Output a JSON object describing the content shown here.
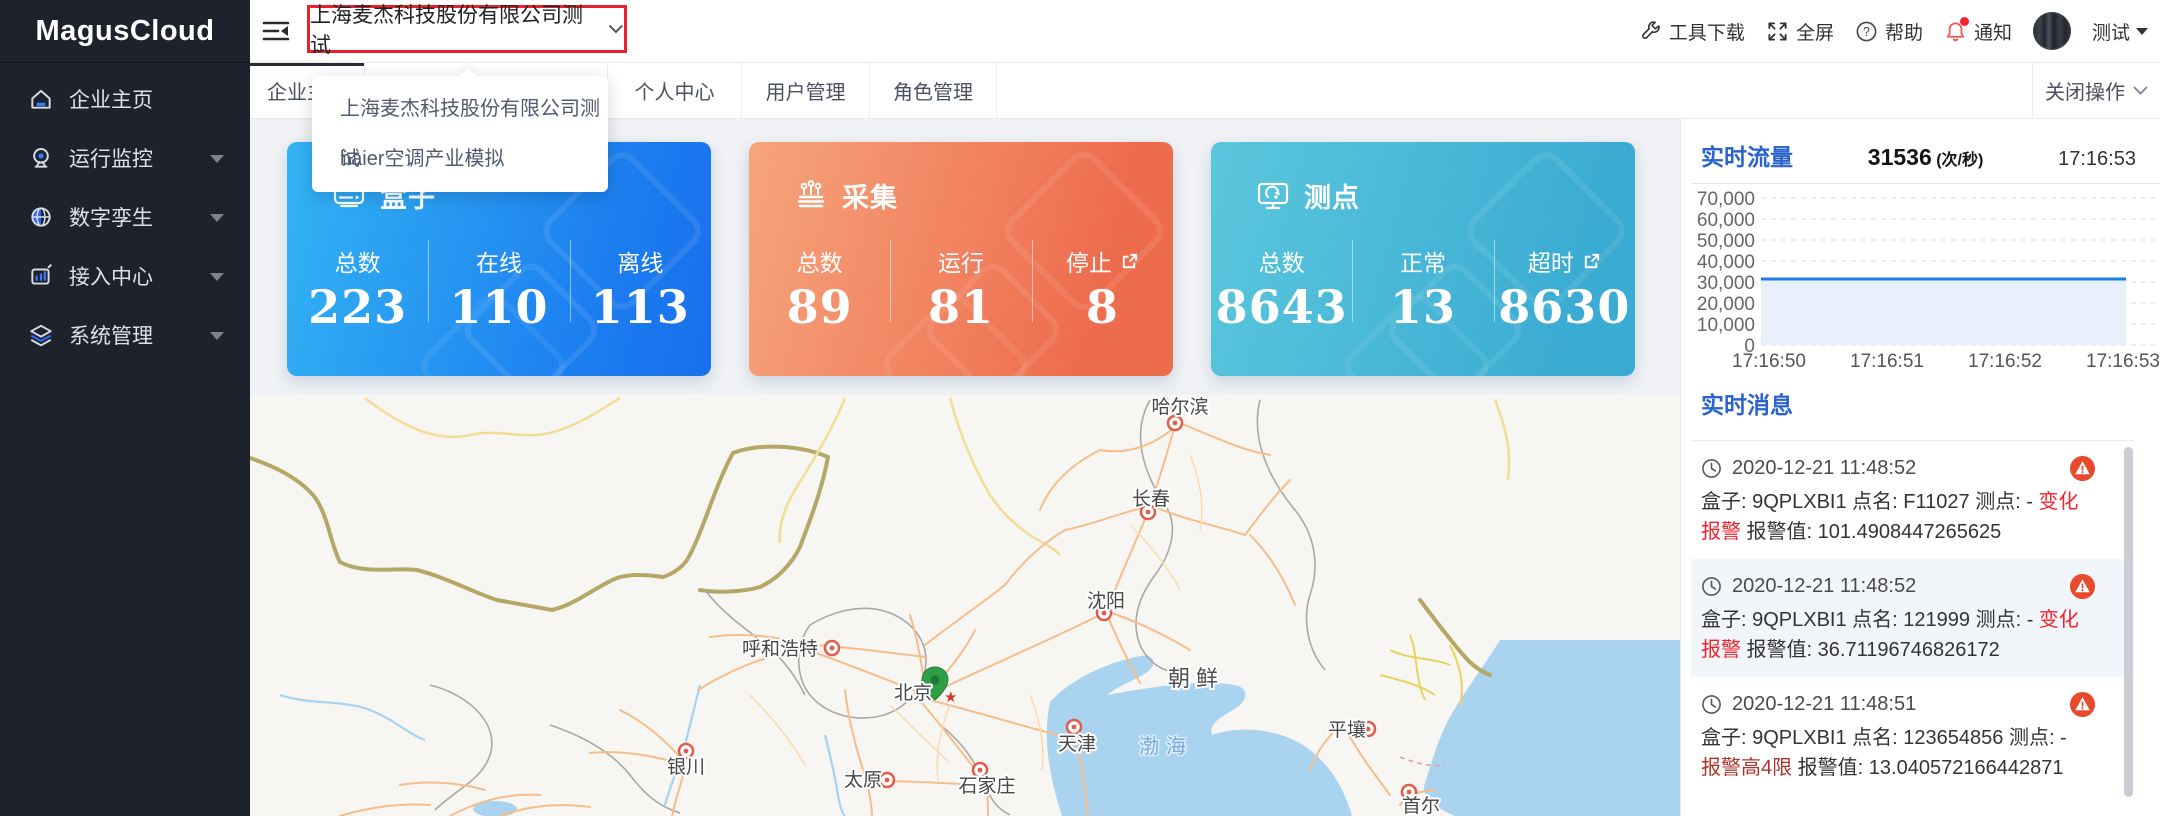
{
  "app": {
    "title": "MagusCloud"
  },
  "sidebar": {
    "items": [
      {
        "label": "企业主页",
        "icon": "home-icon",
        "expandable": false
      },
      {
        "label": "运行监控",
        "icon": "monitor-icon",
        "expandable": true
      },
      {
        "label": "数字孪生",
        "icon": "globe-icon",
        "expandable": true
      },
      {
        "label": "接入中心",
        "icon": "access-icon",
        "expandable": true
      },
      {
        "label": "系统管理",
        "icon": "layers-icon",
        "expandable": true
      }
    ]
  },
  "header": {
    "org_selector": {
      "value": "上海麦杰科技股份有限公司测试"
    },
    "org_dropdown": {
      "options": [
        {
          "label": "上海麦杰科技股份有限公司测试"
        },
        {
          "label": "haier空调产业模拟"
        }
      ]
    },
    "actions": {
      "tools": "工具下载",
      "fullscreen": "全屏",
      "help": "帮助",
      "notice": "通知",
      "user": "测试"
    }
  },
  "tabs": {
    "items": [
      {
        "label": "企业主页",
        "active": true
      },
      {
        "label": "个人中心",
        "active": false
      },
      {
        "label": "用户管理",
        "active": false
      },
      {
        "label": "角色管理",
        "active": false
      }
    ],
    "close_ops": "关闭操作"
  },
  "cards": [
    {
      "title": "盒子",
      "icon": "box-icon",
      "stats": [
        {
          "label": "总数",
          "value": "223"
        },
        {
          "label": "在线",
          "value": "110"
        },
        {
          "label": "离线",
          "value": "113"
        }
      ]
    },
    {
      "title": "采集",
      "icon": "collector-icon",
      "stats": [
        {
          "label": "总数",
          "value": "89"
        },
        {
          "label": "运行",
          "value": "81"
        },
        {
          "label": "停止",
          "value": "8",
          "link": true
        }
      ]
    },
    {
      "title": "测点",
      "icon": "point-icon",
      "stats": [
        {
          "label": "总数",
          "value": "8643"
        },
        {
          "label": "正常",
          "value": "13"
        },
        {
          "label": "超时",
          "value": "8630",
          "link": true
        }
      ]
    }
  ],
  "flow": {
    "title": "实时流量",
    "value": "31536",
    "unit": "(次/秒)",
    "time": "17:16:53"
  },
  "chart_data": {
    "type": "line",
    "title": "实时流量",
    "x": [
      "17:16:50",
      "17:16:51",
      "17:16:52",
      "17:16:53"
    ],
    "series": [
      {
        "name": "实时流量",
        "values": [
          31536,
          31536,
          31536,
          31536
        ]
      }
    ],
    "ylim": [
      0,
      70000
    ],
    "ytick_labels": [
      "70,000",
      "60,000",
      "50,000",
      "40,000",
      "30,000",
      "20,000",
      "10,000",
      "0"
    ],
    "grid": "dashed",
    "legend": "none",
    "current_value": 31536,
    "unit": "(次/秒)"
  },
  "messages": {
    "title": "实时消息",
    "items": [
      {
        "time": "2020-12-21 11:48:52",
        "prefix": "盒子: 9QPLXBI1 点名: F11027 测点: - ",
        "alarm": "变化报警",
        "suffix": " 报警值: 101.4908447265625"
      },
      {
        "time": "2020-12-21 11:48:52",
        "prefix": "盒子: 9QPLXBI1 点名: 121999 测点: - ",
        "alarm": "变化报警",
        "suffix": " 报警值: 36.71196746826172"
      },
      {
        "time": "2020-12-21 11:48:51",
        "prefix": "盒子: 9QPLXBI1 点名: 123654856 测点: - ",
        "alarm": "报警高4限",
        "suffix": " 报警值: 13.040572166442871"
      }
    ]
  },
  "map": {
    "labels": [
      {
        "text": "哈尔滨"
      },
      {
        "text": "长春"
      },
      {
        "text": "沈阳"
      },
      {
        "text": "呼和浩特"
      },
      {
        "text": "北京"
      },
      {
        "text": "天津"
      },
      {
        "text": "石家庄"
      },
      {
        "text": "太原"
      },
      {
        "text": "银川"
      },
      {
        "text": "朝鲜"
      },
      {
        "text": "平壤"
      },
      {
        "text": "首尔"
      }
    ],
    "sea_label": "渤海"
  },
  "colors": {
    "accent_blue": "#2a63cf",
    "selector_border": "#e8212a",
    "card_blue_from": "#33b4f4",
    "card_blue_to": "#1a79ee",
    "card_orange_from": "#f6a57c",
    "card_orange_to": "#ee6c4e",
    "card_teal_from": "#5bc7dd",
    "card_teal_to": "#3aabd2",
    "flow_line_blue": "#1e7ce8",
    "alarm_red": "#f5222d",
    "alarm_dark_red": "#ad342b",
    "badge_red": "#e84a2e",
    "sea_blue": "#a9d3ef"
  }
}
